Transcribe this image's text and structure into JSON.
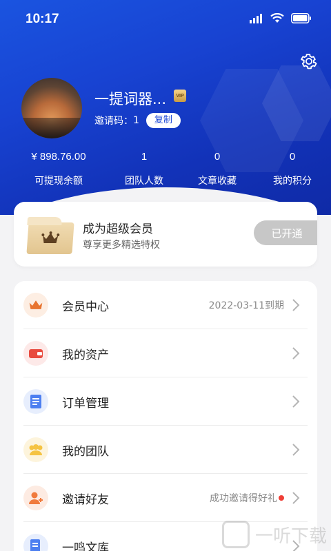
{
  "status_bar": {
    "time": "10:17"
  },
  "profile": {
    "username": "一提词器...",
    "vip_badge": "VIP",
    "invite_label": "邀请码：",
    "invite_code": "1",
    "copy_label": "复制"
  },
  "stats": [
    {
      "value": "¥ 898.76.00",
      "label": "可提现余额"
    },
    {
      "value": "1",
      "label": "团队人数"
    },
    {
      "value": "0",
      "label": "文章收藏"
    },
    {
      "value": "0",
      "label": "我的积分"
    }
  ],
  "membership": {
    "title": "成为超级会员",
    "subtitle": "尊享更多精选特权",
    "button": "已开通"
  },
  "menu": [
    {
      "label": "会员中心",
      "right_text": "2022-03-11到期",
      "icon": "crown-icon",
      "color": "#e8742f"
    },
    {
      "label": "我的资产",
      "right_text": "",
      "icon": "wallet-icon",
      "color": "#e84b3f"
    },
    {
      "label": "订单管理",
      "right_text": "",
      "icon": "document-icon",
      "color": "#4d7ff0"
    },
    {
      "label": "我的团队",
      "right_text": "",
      "icon": "team-icon",
      "color": "#f5c342"
    },
    {
      "label": "邀请好友",
      "right_text": "成功邀请得好礼",
      "icon": "add-user-icon",
      "color": "#f07a3c"
    },
    {
      "label": "一鸣文库",
      "right_text": "",
      "icon": "library-icon",
      "color": "#4d7ff0"
    }
  ],
  "watermark": {
    "text": "一听下载"
  },
  "colors": {
    "header_blue": "#1843d2",
    "accent_blue": "#1a46d6",
    "red_dot": "#ef3e36"
  }
}
